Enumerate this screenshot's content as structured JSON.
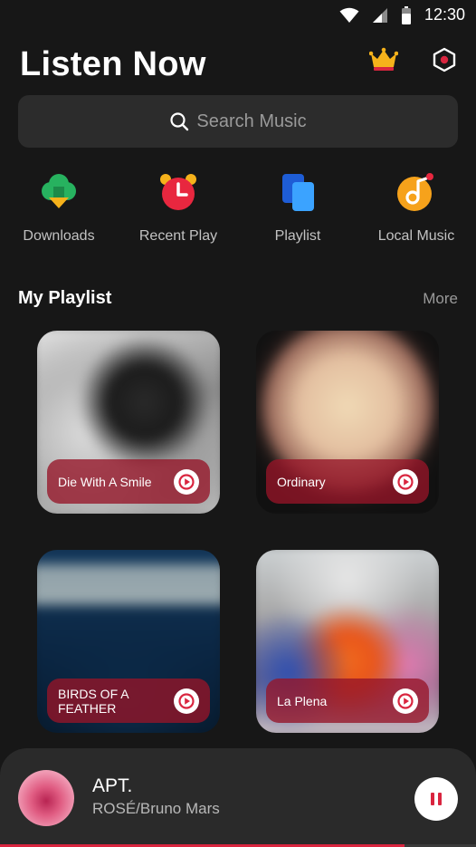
{
  "status_bar": {
    "time": "12:30"
  },
  "header": {
    "title": "Listen Now"
  },
  "search": {
    "placeholder": "Search Music"
  },
  "quick_actions": [
    {
      "label": "Downloads",
      "icon": "download-cloud-icon"
    },
    {
      "label": "Recent Play",
      "icon": "alarm-clock-icon"
    },
    {
      "label": "Playlist",
      "icon": "playlist-stack-icon"
    },
    {
      "label": "Local Music",
      "icon": "music-note-disc-icon"
    }
  ],
  "my_playlist": {
    "title": "My Playlist",
    "more_label": "More",
    "items": [
      {
        "title": "Die With A Smile"
      },
      {
        "title": "Ordinary"
      },
      {
        "title": "BIRDS OF A FEATHER"
      },
      {
        "title": "La Plena"
      }
    ]
  },
  "now_playing": {
    "title": "APT.",
    "artist": "ROSÉ/Bruno Mars",
    "progress": 0.85
  },
  "colors": {
    "accent": "#d9253f",
    "background": "#171717",
    "surface": "#2c2c2c"
  }
}
